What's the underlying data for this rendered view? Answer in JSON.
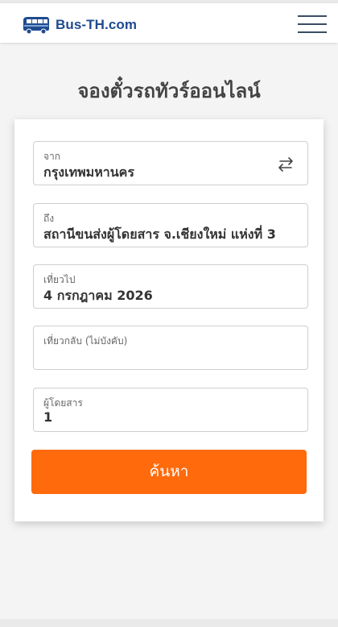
{
  "header": {
    "logo_text": "Bus-TH.com",
    "logo_icon": "bus-icon",
    "menu_icon": "hamburger-menu-icon"
  },
  "page": {
    "title": "จองตั๋วรถทัวร์ออนไลน์"
  },
  "form": {
    "from": {
      "label": "จาก",
      "value": "กรุงเทพมหานคร"
    },
    "swap_icon": "swap-arrows-icon",
    "to": {
      "label": "ถึง",
      "value": "สถานีขนส่งผู้โดยสาร จ.เชียงใหม่ แห่งที่ 3"
    },
    "depart": {
      "label": "เที่ยวไป",
      "value": "4 กรกฎาคม 2026"
    },
    "return": {
      "label": "เที่ยวกลับ (ไม่บังคับ)",
      "value": ""
    },
    "passengers": {
      "label": "ผู้โดยสาร",
      "value": "1"
    },
    "search_label": "ค้นหา"
  },
  "colors": {
    "brand_blue": "#1f4b8f",
    "accent_orange": "#ff6a0d"
  }
}
